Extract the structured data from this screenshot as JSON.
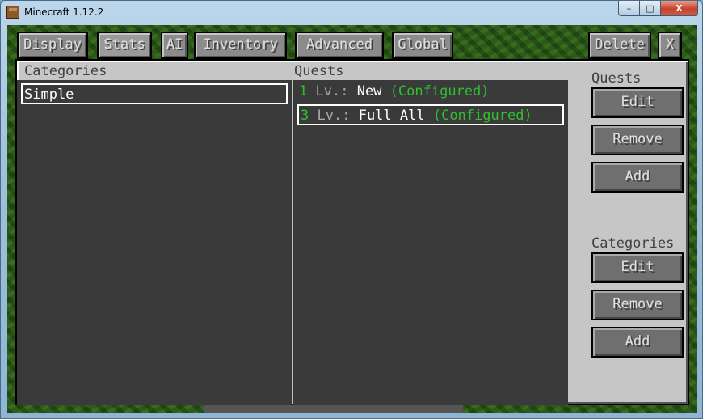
{
  "window": {
    "title": "Minecraft 1.12.2",
    "controls": {
      "minimize": "–",
      "maximize": "□",
      "close": "X"
    }
  },
  "tabs": [
    {
      "label": "Display"
    },
    {
      "label": "Stats"
    },
    {
      "label": "AI"
    },
    {
      "label": "Inventory"
    },
    {
      "label": "Advanced"
    },
    {
      "label": "Global"
    }
  ],
  "top_right": {
    "delete_label": "Delete",
    "close_label": "X"
  },
  "categories": {
    "header": "Categories",
    "items": [
      {
        "label": "Simple",
        "selected": true
      }
    ]
  },
  "quests": {
    "header": "Quests",
    "items": [
      {
        "num": "1",
        "lv": "Lv.:",
        "name": "New",
        "status": "(Configured)",
        "selected": false
      },
      {
        "num": "3",
        "lv": "Lv.:",
        "name": "Full All",
        "status": "(Configured)",
        "selected": true
      }
    ]
  },
  "side": {
    "quests_label": "Quests",
    "quests_edit": "Edit",
    "quests_remove": "Remove",
    "quests_add": "Add",
    "categories_label": "Categories",
    "categories_edit": "Edit",
    "categories_remove": "Remove",
    "categories_add": "Add"
  },
  "colors": {
    "panel": "#c6c6c6",
    "list_bg": "#3a3a3a",
    "configured_green": "#2fbf2f"
  }
}
